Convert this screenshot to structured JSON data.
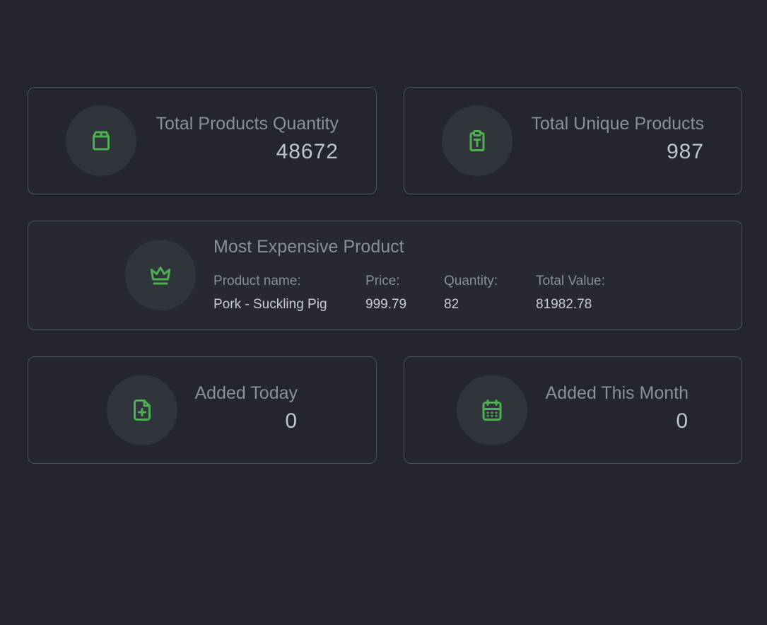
{
  "stats": {
    "total_quantity": {
      "label": "Total Products Quantity",
      "value": "48672",
      "icon": "box-icon"
    },
    "unique_products": {
      "label": "Total Unique Products",
      "value": "987",
      "icon": "clipboard-text-icon"
    },
    "added_today": {
      "label": "Added Today",
      "value": "0",
      "icon": "file-plus-icon"
    },
    "added_month": {
      "label": "Added This Month",
      "value": "0",
      "icon": "calendar-icon"
    }
  },
  "most_expensive": {
    "title": "Most Expensive Product",
    "icon": "crown-icon",
    "product_name_label": "Product name:",
    "product_name": "Pork - Suckling Pig",
    "price_label": "Price:",
    "price": "999.79",
    "quantity_label": "Quantity:",
    "quantity": "82",
    "total_value_label": "Total Value:",
    "total_value": "81982.78"
  },
  "colors": {
    "background": "#22262c",
    "accent": "#4caf50",
    "card_border": "#4d5356"
  }
}
